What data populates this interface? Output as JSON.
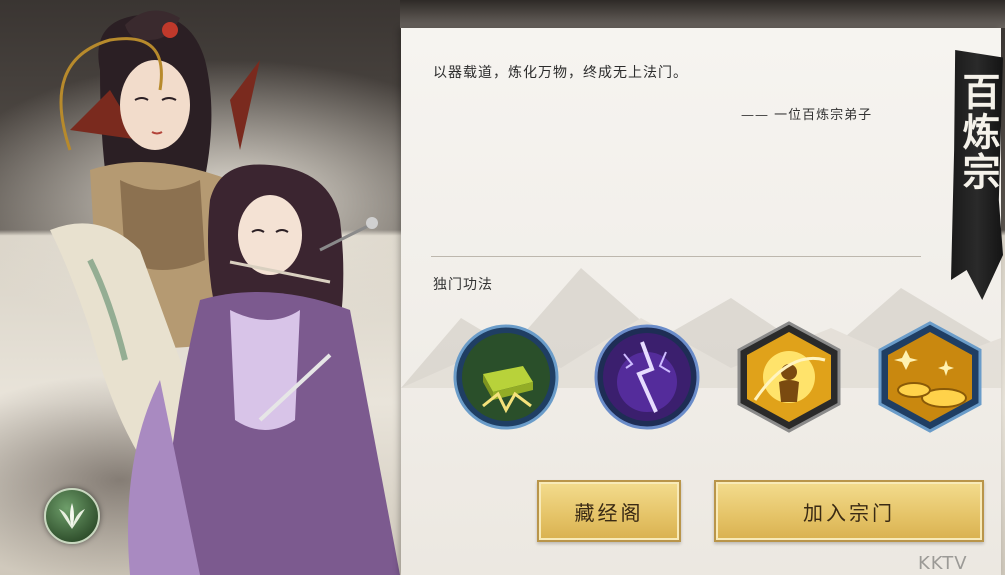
{
  "panel": {
    "quote": "以器载道，炼化万物，终成无上法门。",
    "quote_source": "—— 一位百炼宗弟子",
    "skills_heading": "独门功法"
  },
  "sect": {
    "name": "百炼宗"
  },
  "skills": [
    {
      "icon": "gold-bar-forge-icon",
      "shape": "round",
      "accent": "#2e6fa3"
    },
    {
      "icon": "purple-lightning-icon",
      "shape": "round",
      "accent": "#6a3bb5"
    },
    {
      "icon": "golden-aura-figure-icon",
      "shape": "hexagon",
      "accent": "#e0a21a"
    },
    {
      "icon": "golden-coins-icon",
      "shape": "hexagon",
      "accent": "#e0a21a"
    }
  ],
  "buttons": {
    "library_label": "藏经阁",
    "join_label": "加入宗门"
  },
  "watermark": "KKTV",
  "colors": {
    "button_gold": "#e6c56a",
    "panel_bg": "#f3f0eb",
    "banner_ink": "#1a1a1a"
  }
}
